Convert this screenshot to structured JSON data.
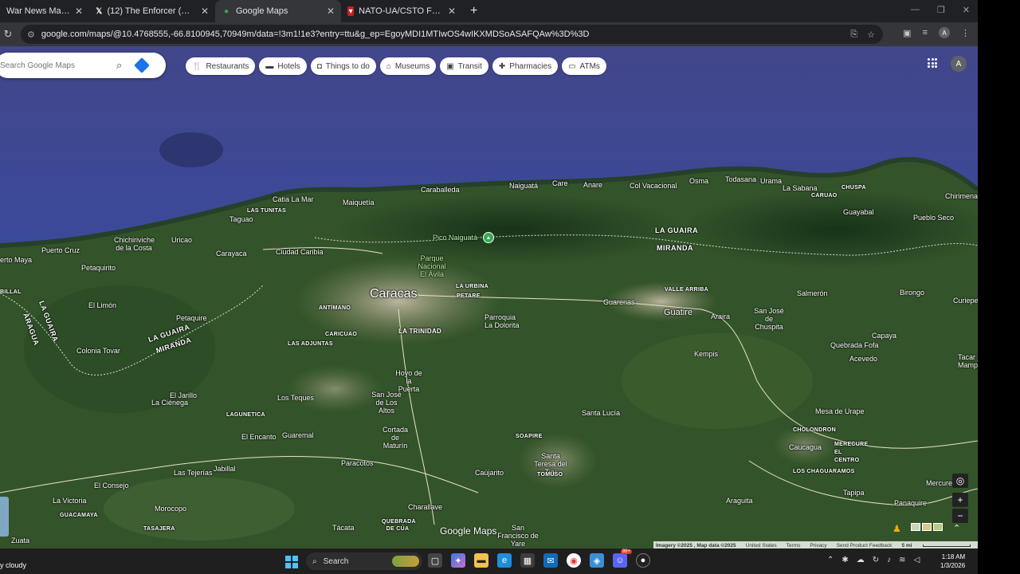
{
  "browser": {
    "tabs": [
      {
        "title": "War News Map Day 140",
        "active": false,
        "icon": "news-icon"
      },
      {
        "title": "(12) The Enforcer (@ItsTheEnfo",
        "active": false,
        "icon": "x-logo-icon"
      },
      {
        "title": "Google Maps",
        "active": true,
        "icon": "maps-pin-icon"
      },
      {
        "title": "NATO-UA/CSTO Force Disposit",
        "active": false,
        "icon": "map-marker-icon"
      }
    ],
    "new_tab": "+",
    "url": "google.com/maps/@10.4768555,-66.8100945,70949m/data=!3m1!1e3?entry=ttu&g_ep=EgoyMDI1MTIwOS4wIKXMDSoASAFQAw%3D%3D",
    "profile_initial": "A"
  },
  "maps": {
    "search_placeholder": "Search Google Maps",
    "chips": [
      {
        "label": "Restaurants",
        "icon": "fork-knife-icon"
      },
      {
        "label": "Hotels",
        "icon": "bed-icon"
      },
      {
        "label": "Things to do",
        "icon": "camera-icon"
      },
      {
        "label": "Museums",
        "icon": "museum-icon"
      },
      {
        "label": "Transit",
        "icon": "bus-icon"
      },
      {
        "label": "Pharmacies",
        "icon": "pharmacy-icon"
      },
      {
        "label": "ATMs",
        "icon": "atm-icon"
      }
    ],
    "account_initial": "A",
    "logo": "Google Maps",
    "attribution": {
      "imagery": "Imagery ©2025 , Map data ©2025",
      "links": [
        "United States",
        "Terms",
        "Privacy",
        "Send Product Feedback"
      ],
      "scale": "5 mi"
    },
    "places": {
      "caracas": "Caracas",
      "guatire": "Guatire",
      "pico": "Pico Naiguatá",
      "parque": "Parque Nacional El Ávila",
      "la_guaira_1": "LA GUAIRA",
      "miranda_1": "MIRANDA",
      "la_guaira_2": "LA GUAIRA",
      "miranda_2": "MIRANDA",
      "la_guaira_3": "LA GUAIRA",
      "aragua": "ARAGUA",
      "maiquetia": "Maiquetía",
      "catia": "Catia La Mar",
      "las_tunitas": "LAS TUNITAS",
      "tagua": "Taguao",
      "caraballeda": "Caraballeda",
      "naiguata": "Naiguatá",
      "care": "Care",
      "anare": "Anare",
      "col_vacacional": "Col Vacacional",
      "osma": "Osma",
      "todasana": "Todasana",
      "urama": "Urama",
      "la_sabana": "La Sabana",
      "caruao": "CARUAO",
      "chuspa": "CHUSPA",
      "chirimena": "Chirimena",
      "guayabal": "Guayabal",
      "pueblo_seco": "Pueblo Seco",
      "chichiriviche": "Chichiriviche de la Costa",
      "puerto_cruz": "Puerto Cruz",
      "uricao": "Uricao",
      "carayaca": "Carayaca",
      "ciudad_caribia": "Ciudad Caribia",
      "petaquirito": "Petaquirito",
      "puerto_maya": "erto Maya",
      "el_limon": "El Limón",
      "petaquire": "Petaquire",
      "antimano": "ANTÍMANO",
      "la_urbina": "LA URBINA",
      "petare": "PETARE",
      "la_trinidad": "LA TRINIDAD",
      "caricuao": "CARICUAO",
      "las_adjuntas": "LAS ADJUNTAS",
      "la_dolorita": "Parroquia La Dolorita",
      "guarenas": "Guarenas",
      "valle_arriba": "VALLE ARRIBA",
      "araira": "Araira",
      "salmeron": "Salmerón",
      "birongo": "Birongo",
      "curiepe": "Curiepe",
      "san_jose_chuspita": "San José de Chuspita",
      "kempis": "Kempis",
      "capaya": "Capaya",
      "quebrada_fofa": "Quebrada Fofa",
      "acevedo": "Acevedo",
      "tacarigua": "Tacar Mamp",
      "colonia_tovar": "Colonia Tovar",
      "hoyo_puerta": "Hoyo de la Puerta",
      "san_jose_altos": "San José de Los Altos",
      "los_teques": "Los Teques",
      "el_jarillo": "El Jarillo",
      "la_cienega": "La Ciénega",
      "lagunetica": "LAGUNETICA",
      "el_encanto": "El Encanto",
      "guaremal": "Guaremal",
      "cortada_maturin": "Cortada de Maturín",
      "santa_lucia": "Santa Lucía",
      "soapire": "SOAPIRE",
      "santa_teresa": "Santa Teresa del Tuy",
      "tomuso": "TOMUSO",
      "mesa_urape": "Mesa de Urape",
      "cholondron": "CHOLONDRON",
      "caucagua": "Caucagua",
      "mercure": "MERECURE EL CENTRO",
      "los_chaguaramos": "LOS CHAGUARAMOS",
      "paracotos": "Paracotos",
      "cajurito": "Caújarito",
      "el_consejo": "El Consejo",
      "las_tejerias": "Las Tejerías",
      "jabillal": "Jabillal",
      "la_victoria": "La Victoria",
      "guacamaya": "GUACAMAYA",
      "morocopo": "Morocopo",
      "charallave": "Charallave",
      "quebrada_cua": "QUEBRADA DE CÚA",
      "tacata": "Tácata",
      "tasajera": "TASAJERA",
      "san_francisco_yare": "San Francisco de Yare",
      "zuata": "Zuata",
      "araguita": "Araguita",
      "tapipa": "Tapipa",
      "panaquire": "Panaquire",
      "mercure2": "Mercure",
      "billal": "BILLAL"
    }
  },
  "taskbar": {
    "weather": "y cloudy",
    "search_label": "Search",
    "time": "1:18 AM",
    "date": "1/3/2026",
    "badge": "99+"
  }
}
